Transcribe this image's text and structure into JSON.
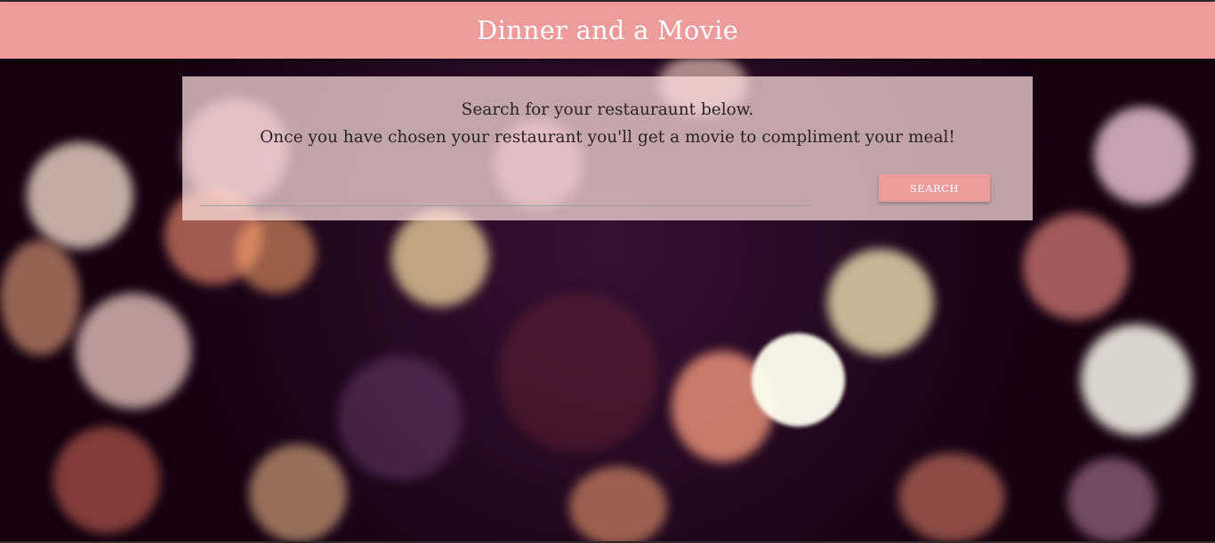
{
  "navbar": {
    "brand": "Dinner and a Movie"
  },
  "search_card": {
    "line1": "Search for your restauraunt below.",
    "line2": "Once you have chosen your restaurant you'll get a movie to compliment your meal!",
    "input_value": "",
    "button_label": "Search"
  },
  "colors": {
    "accent": "#ee9b9b",
    "card_background": "#ffe1e1",
    "text": "#2c2224"
  },
  "background": {
    "description_icon": "bokeh-lights-background"
  }
}
